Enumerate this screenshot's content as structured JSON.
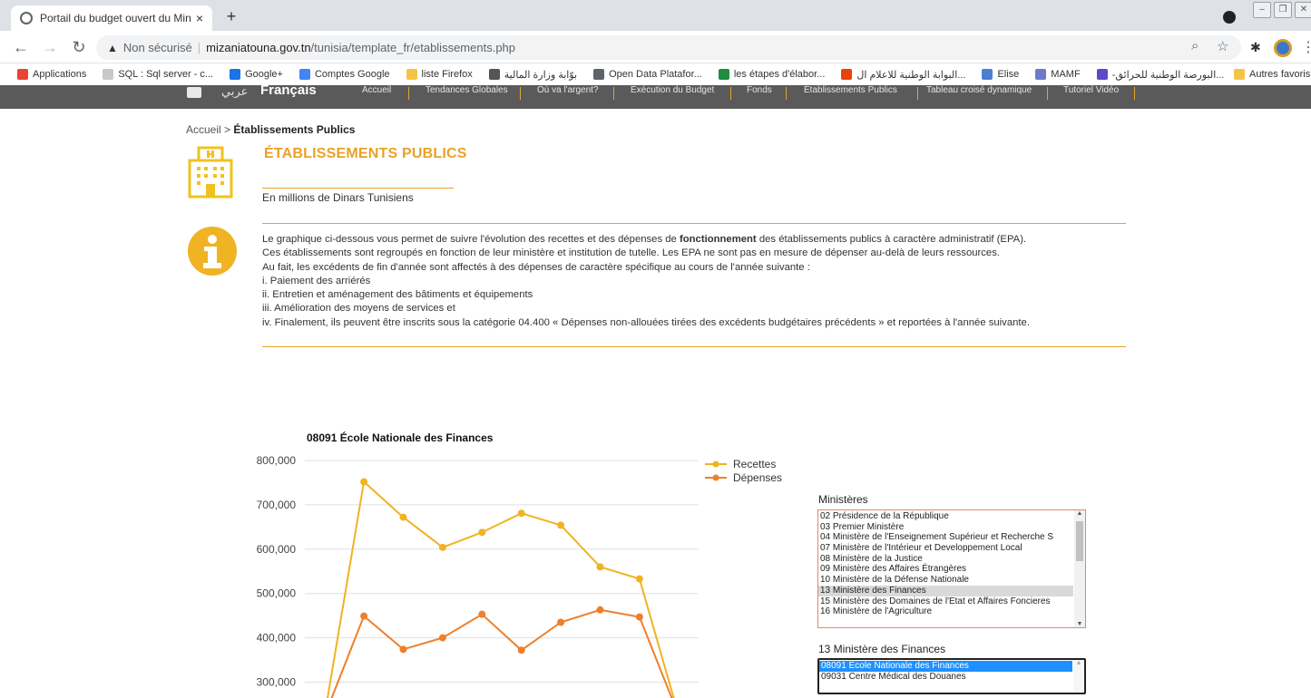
{
  "browser": {
    "tab_title": "Portail du budget ouvert du Mini",
    "tab_close": "×",
    "new_tab": "+",
    "insecure_label": "Non sécurisé",
    "url_domain": "mizaniatouna.gov.tn",
    "url_path": "/tunisia/template_fr/etablissements.php",
    "bookmarks": [
      {
        "label": "Applications",
        "color": "#ea4335",
        "icon": "apps-grid-icon"
      },
      {
        "label": "SQL : Sql server - c...",
        "color": "#c8c8c8",
        "icon": "sql-icon"
      },
      {
        "label": "Google+",
        "color": "#1a73e8",
        "icon": "google-plus-icon"
      },
      {
        "label": "Comptes Google",
        "color": "#4285f4",
        "icon": "google-icon"
      },
      {
        "label": "liste Firefox",
        "color": "#f6c445",
        "icon": "folder-icon"
      },
      {
        "label": "بوّابة وزارة المالية",
        "color": "#555555",
        "icon": "ministry-icon"
      },
      {
        "label": "Open Data Platafor...",
        "color": "#5f6368",
        "icon": "globe-icon"
      },
      {
        "label": "les étapes d'élabor...",
        "color": "#1e8e3e",
        "icon": "vp-icon"
      },
      {
        "label": "البوابة الوطنية للاعلام ال...",
        "color": "#e8430a",
        "icon": "portal-icon"
      },
      {
        "label": "Elise",
        "color": "#4a7fd4",
        "icon": "elise-icon"
      },
      {
        "label": "MAMF",
        "color": "#6c7ac9",
        "icon": "mamf-icon"
      },
      {
        "label": "-البورصة الوطنية للحرائق...",
        "color": "#5b4bc9",
        "icon": "list-icon"
      }
    ],
    "bookmarks_other": "Autres favoris"
  },
  "site_nav": {
    "lang_ar": "عربي",
    "lang_fr": "Français",
    "items": [
      "Accueil",
      "Tendances Globales",
      "Où va l'argent?",
      "Exécution du Budget",
      "Fonds",
      "Établissements Publics",
      "Tableau croisé dynamique",
      "Tutoriel Vidéo"
    ]
  },
  "breadcrumb": {
    "home": "Accueil",
    "separator": ">",
    "current": "Établissements Publics"
  },
  "page": {
    "title": "ÉTABLISSEMENTS PUBLICS",
    "unit": "En millions de Dinars Tunisiens",
    "accent": "#e8a227"
  },
  "info": {
    "line1_before": "Le graphique ci-dessous vous permet de suivre l'évolution des recettes et des dépenses de ",
    "line1_bold": "fonctionnement",
    "line1_after": " des établissements publics à caractère administratif (EPA).",
    "line2": "Ces établissements sont regroupés en fonction de leur ministère et institution de tutelle. Les EPA ne sont pas en mesure de dépenser au-delà de leurs ressources.",
    "line3": "Au fait, les excédents de fin d'année sont affectés à des dépenses de caractère spécifique au cours de l'année suivante :",
    "line4": "i. Paiement des arriérés",
    "line5": "ii. Entretien et aménagement des bâtiments et équipements",
    "line6": "iii. Amélioration des moyens de services et",
    "line7": "iv. Finalement, ils peuvent être inscrits sous la catégorie 04.400 « Dépenses non-allouées tirées des excédents budgétaires précédents » et reportées à l'année suivante."
  },
  "chart_data": {
    "type": "line",
    "title": "08091 École Nationale des Finances",
    "ylim": [
      300000,
      800000
    ],
    "ytick_labels": [
      "800,000",
      "700,000",
      "600,000",
      "500,000",
      "400,000",
      "300,000"
    ],
    "yticks": [
      800000,
      700000,
      600000,
      500000,
      400000,
      300000
    ],
    "grid": true,
    "legend_position": "top-right",
    "series": [
      {
        "name": "Recettes",
        "color": "#f0b323",
        "values": [
          null,
          752000,
          672000,
          604000,
          638000,
          681000,
          654000,
          560000,
          533000,
          null
        ]
      },
      {
        "name": "Dépenses",
        "color": "#ee7f2d",
        "values": [
          null,
          449000,
          374000,
          400000,
          453000,
          372000,
          435000,
          463000,
          447000,
          null
        ]
      }
    ]
  },
  "ministeres": {
    "label": "Ministères",
    "options": [
      "02 Présidence de la République",
      "03 Premier Ministère",
      "04 Ministère de l'Enseignement Supérieur et Recherche S",
      "07 Ministère de l'Intérieur et Developpement Local",
      "08 Ministère de la Justice",
      "09 Ministère des Affaires Étrangères",
      "10 Ministère de la Défense Nationale",
      "13 Ministère des Finances",
      "15 Ministère des Domaines de l'Etat et Affaires Foncieres",
      "16 Ministère de l'Agriculture"
    ],
    "selected": "13 Ministère des Finances"
  },
  "etablissements": {
    "label": "13 Ministère des Finances",
    "options": [
      "08091 Ecole Nationale des Finances",
      "09031 Centre Médical des Douanes"
    ],
    "selected": "08091 Ecole Nationale des Finances"
  }
}
